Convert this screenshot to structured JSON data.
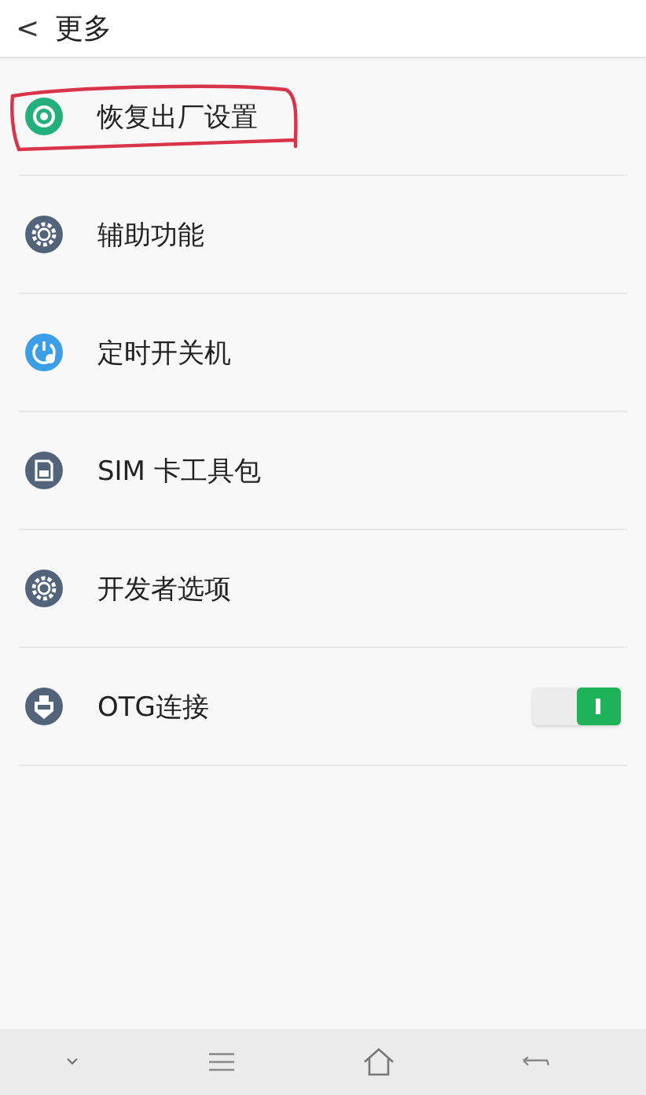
{
  "header": {
    "back": "<",
    "title": "更多"
  },
  "items": [
    {
      "kind": "link",
      "label": "恢复出厂设置",
      "annotated": true
    },
    {
      "kind": "link",
      "label": "辅助功能",
      "annotated": false
    },
    {
      "kind": "link",
      "label": "定时开关机",
      "annotated": false
    },
    {
      "kind": "link",
      "label": "SIM 卡工具包",
      "annotated": false
    },
    {
      "kind": "link",
      "label": "开发者选项",
      "annotated": false
    },
    {
      "kind": "toggle",
      "label": "OTG连接",
      "annotated": false,
      "on": true
    }
  ]
}
